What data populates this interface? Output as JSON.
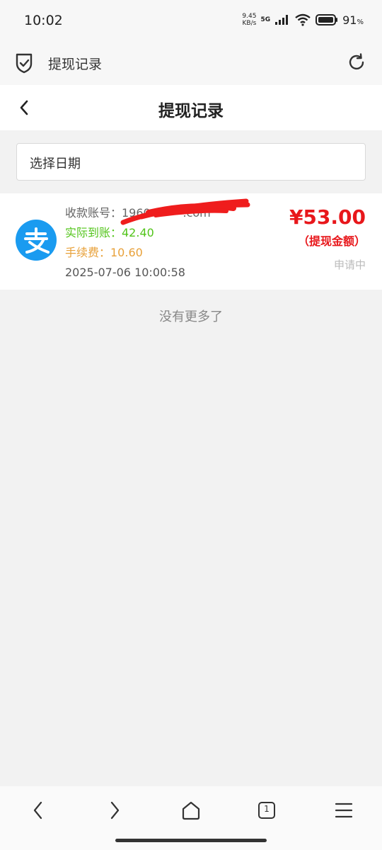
{
  "status_bar": {
    "time": "10:02",
    "net_speed_value": "9.45",
    "net_speed_unit": "KB/s",
    "network": "5G",
    "battery": "91",
    "battery_unit": "%"
  },
  "browser_bar": {
    "title": "提现记录",
    "left_icon": "shield-check-icon",
    "right_icon": "refresh-icon"
  },
  "header": {
    "title": "提现记录",
    "back_icon": "chevron-left-icon"
  },
  "date_picker": {
    "label": "选择日期"
  },
  "records": [
    {
      "icon": "alipay-icon",
      "account": "收款账号：1960·········.com",
      "actual": "实际到账：42.40",
      "fee": "手续费：10.60",
      "time": "2025-07-06 10:00:58",
      "amount": "¥53.00",
      "amount_label": "（提现金额）",
      "status": "申请中"
    }
  ],
  "footer_text": "没有更多了",
  "bottom_nav": {
    "tab_count": "1",
    "icons": [
      "back-icon",
      "forward-icon",
      "home-icon",
      "tabs-icon",
      "menu-icon"
    ]
  },
  "colors": {
    "amount_red": "#e8171b",
    "actual_green": "#52c41a",
    "fee_orange": "#e8a13a",
    "alipay_blue": "#1a9bf0"
  }
}
